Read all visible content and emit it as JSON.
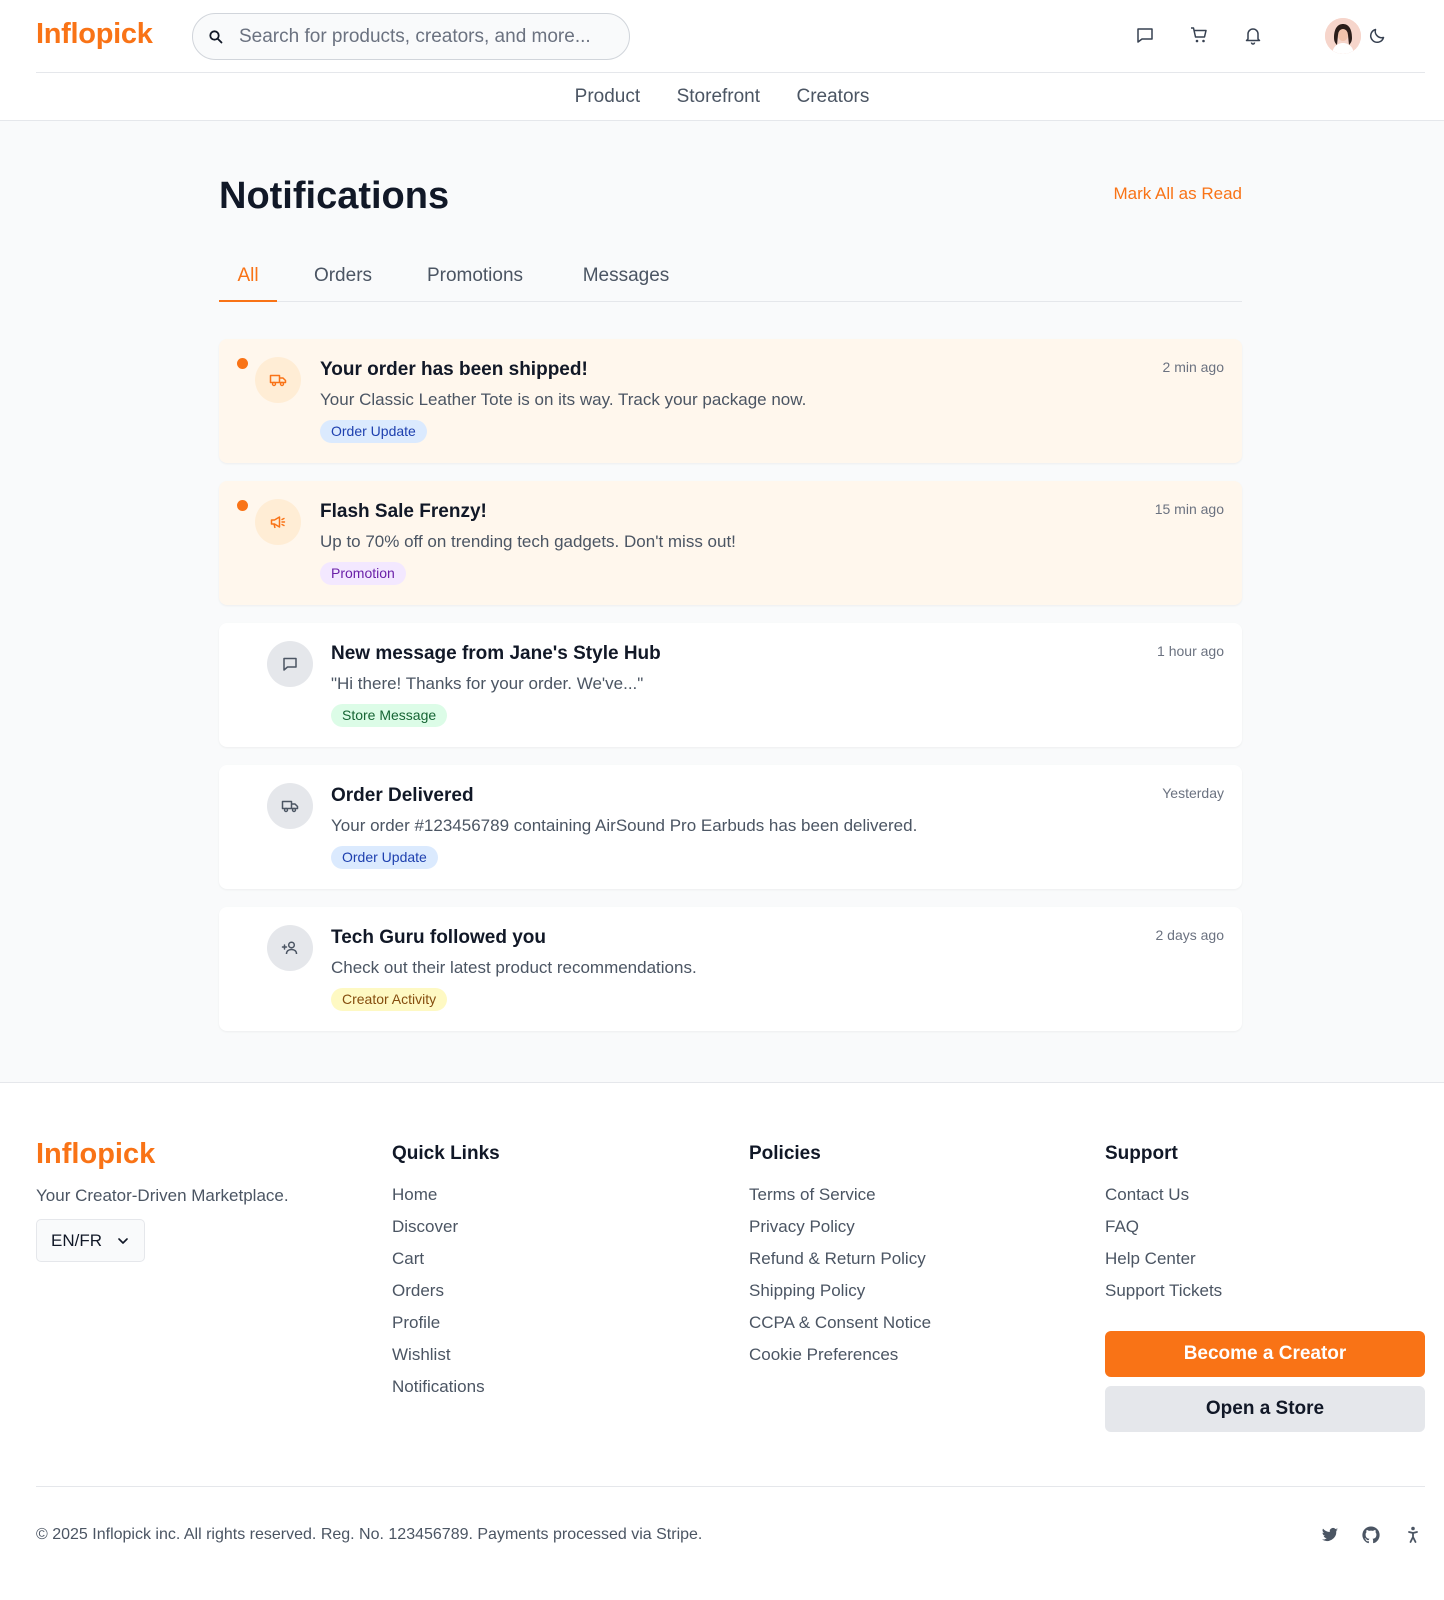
{
  "brand": {
    "name": "Inflopick",
    "accent": "#f97316"
  },
  "search": {
    "placeholder": "Search for products, creators, and more..."
  },
  "header_icons": [
    "message-icon",
    "cart-icon",
    "bell-icon",
    "avatar",
    "moon-icon"
  ],
  "nav": {
    "items": [
      "Product",
      "Storefront",
      "Creators"
    ]
  },
  "page": {
    "title": "Notifications",
    "mark_all": "Mark All as Read"
  },
  "tabs": [
    {
      "label": "All",
      "active": true
    },
    {
      "label": "Orders",
      "active": false
    },
    {
      "label": "Promotions",
      "active": false
    },
    {
      "label": "Messages",
      "active": false
    }
  ],
  "notifications": [
    {
      "icon": "truck-icon",
      "unread": true,
      "title": "Your order has been shipped!",
      "body": "Your Classic Leather Tote is on its way. Track your package now.",
      "tag": "Order Update",
      "tag_bg": "#dbeafe",
      "tag_color": "#1e40af",
      "time": "2 min ago"
    },
    {
      "icon": "megaphone-icon",
      "unread": true,
      "title": "Flash Sale Frenzy!",
      "body": "Up to 70% off on trending tech gadgets. Don't miss out!",
      "tag": "Promotion",
      "tag_bg": "#f3e8ff",
      "tag_color": "#6b21a8",
      "time": "15 min ago"
    },
    {
      "icon": "message-icon",
      "unread": false,
      "title": "New message from Jane's Style Hub",
      "body": "\"Hi there! Thanks for your order. We've...\"",
      "tag": "Store Message",
      "tag_bg": "#dcfce7",
      "tag_color": "#166534",
      "time": "1 hour ago"
    },
    {
      "icon": "truck-icon",
      "unread": false,
      "title": "Order Delivered",
      "body": "Your order #123456789 containing AirSound Pro Earbuds has been delivered.",
      "tag": "Order Update",
      "tag_bg": "#dbeafe",
      "tag_color": "#1e40af",
      "time": "Yesterday"
    },
    {
      "icon": "user-plus-icon",
      "unread": false,
      "title": "Tech Guru followed you",
      "body": "Check out their latest product recommendations.",
      "tag": "Creator Activity",
      "tag_bg": "#fef9c3",
      "tag_color": "#854d0e",
      "time": "2 days ago"
    }
  ],
  "footer": {
    "brand": "Inflopick",
    "tagline": "Your Creator-Driven Marketplace.",
    "language": "EN/FR",
    "quick_links": {
      "title": "Quick Links",
      "items": [
        "Home",
        "Discover",
        "Cart",
        "Orders",
        "Profile",
        "Wishlist",
        "Notifications"
      ]
    },
    "policies": {
      "title": "Policies",
      "items": [
        "Terms of Service",
        "Privacy Policy",
        "Refund & Return Policy",
        "Shipping Policy",
        "CCPA & Consent Notice",
        "Cookie Preferences"
      ]
    },
    "support": {
      "title": "Support",
      "items": [
        "Contact Us",
        "FAQ",
        "Help Center",
        "Support Tickets"
      ]
    },
    "become_creator": "Become a Creator",
    "open_store": "Open a Store",
    "copyright": "© 2025 Inflopick inc. All rights reserved. Reg. No. 123456789. Payments processed via Stripe.",
    "social": [
      "twitter-icon",
      "github-icon",
      "accessibility-icon"
    ]
  }
}
